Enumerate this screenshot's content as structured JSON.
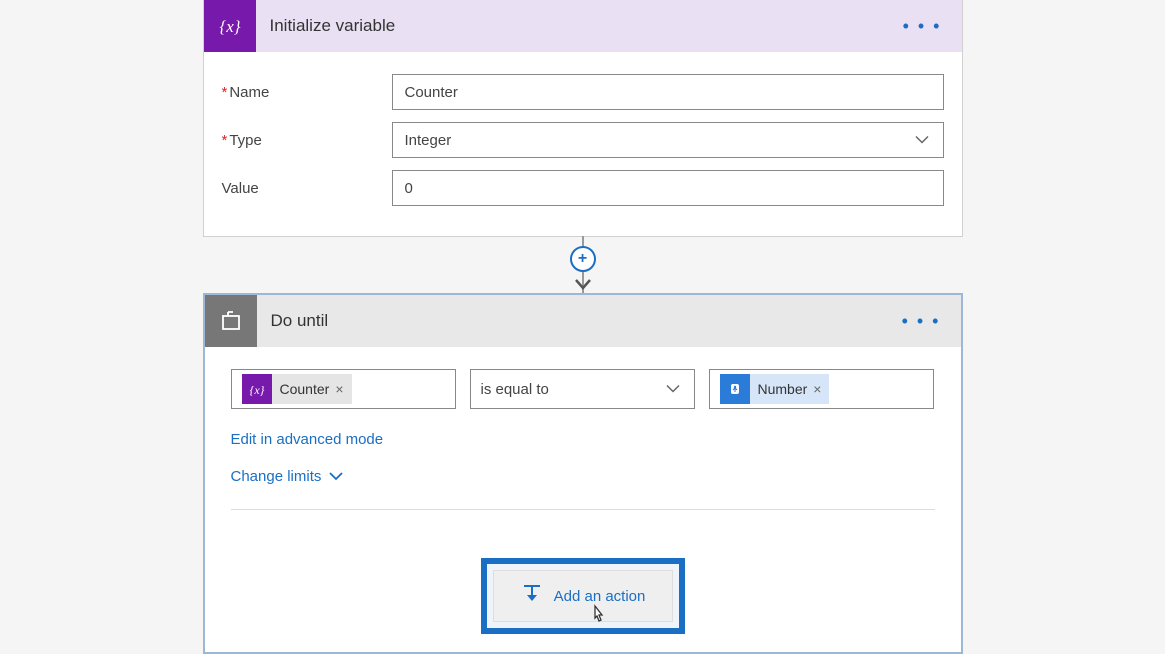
{
  "card1": {
    "title": "Initialize variable",
    "fields": {
      "name": {
        "label": "Name",
        "value": "Counter",
        "required": true
      },
      "type": {
        "label": "Type",
        "value": "Integer",
        "required": true
      },
      "value": {
        "label": "Value",
        "value": "0",
        "required": false
      }
    }
  },
  "card2": {
    "title": "Do until",
    "condition": {
      "left": {
        "pill": "Counter"
      },
      "operator": "is equal to",
      "right": {
        "pill": "Number"
      }
    },
    "links": {
      "advanced": "Edit in advanced mode",
      "limits": "Change limits"
    },
    "addAction": "Add an action"
  }
}
